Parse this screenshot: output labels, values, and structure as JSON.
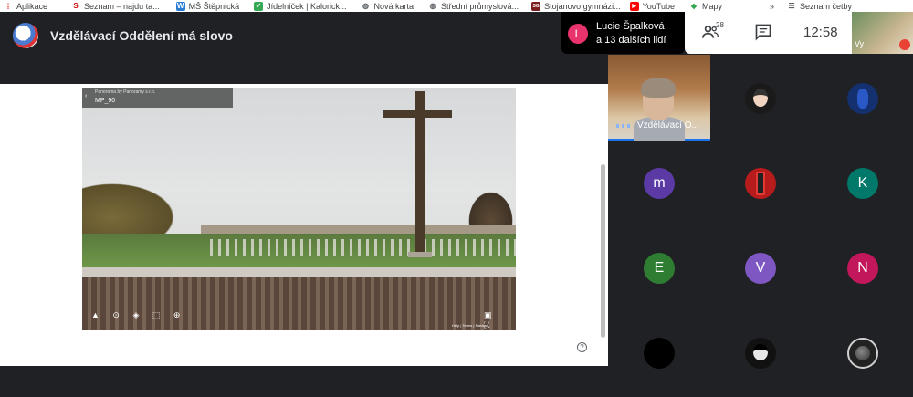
{
  "bookmarks": [
    {
      "label": "Aplikace",
      "icon": "apps-grid-icon",
      "color": "#ea4335"
    },
    {
      "label": "Seznam – najdu ta...",
      "icon": "seznam-logo-icon",
      "color": "#cc0000"
    },
    {
      "label": "MŠ Štěpnická",
      "icon": "word-doc-icon",
      "color": "#2b7cd3"
    },
    {
      "label": "Jídelníček | Kalorick...",
      "icon": "checkbox-icon",
      "color": "#34a853"
    },
    {
      "label": "Nová karta",
      "icon": "globe-icon",
      "color": "#5f6368"
    },
    {
      "label": "Střední průmyslová...",
      "icon": "globe-icon",
      "color": "#5f6368"
    },
    {
      "label": "Stojanovo gymnázi...",
      "icon": "school-logo-icon",
      "color": "#7a1c1c"
    },
    {
      "label": "YouTube",
      "icon": "youtube-icon",
      "color": "#ff0000"
    },
    {
      "label": "Mapy",
      "icon": "maps-icon",
      "color": "#34a853"
    }
  ],
  "bookmarks_more": "»",
  "reading_list": {
    "label": "Seznam četby",
    "icon": "reading-list-icon"
  },
  "meeting": {
    "title": "Vzdělávací Oddělení má slovo",
    "presenter_initial": "L",
    "presenter_name": "Lucie Špalková",
    "presenter_sub": "a 13 dalších lidí",
    "people_count": "28",
    "clock": "12:58",
    "self_label": "Vy"
  },
  "photo": {
    "provider": "Panorama by Panoramy s.r.o.",
    "code": "MP_90",
    "credit": "Help | Terms | Nahlásit"
  },
  "tiles": {
    "main_label": "Vzdělávací O...",
    "participants": [
      {
        "initial": "",
        "color": "#1a1a1a"
      },
      {
        "initial": "",
        "color": "#15306e"
      },
      {
        "initial": "m",
        "color": "#5b3aa6"
      },
      {
        "initial": "",
        "color": "#b71c1c"
      },
      {
        "initial": "K",
        "color": "#00796b"
      },
      {
        "initial": "E",
        "color": "#2e7d32"
      },
      {
        "initial": "V",
        "color": "#7e57c2"
      },
      {
        "initial": "N",
        "color": "#c2185b"
      },
      {
        "initial": "",
        "color": "#000000"
      },
      {
        "initial": "",
        "color": "#111111"
      },
      {
        "initial": "",
        "color": "#222222"
      }
    ]
  }
}
